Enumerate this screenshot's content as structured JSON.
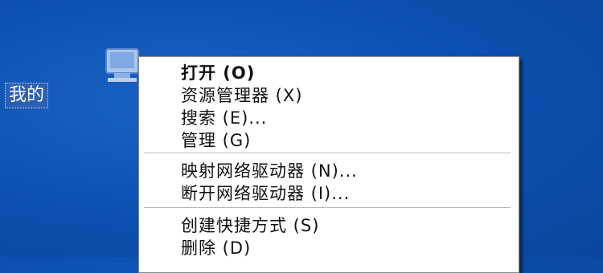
{
  "desktop": {
    "icon_label": "我的"
  },
  "menu": {
    "groups": [
      [
        {
          "label": "打开 (O)",
          "bold": true
        },
        {
          "label": "资源管理器 (X)"
        },
        {
          "label": "搜索 (E)..."
        },
        {
          "label": "管理 (G)"
        }
      ],
      [
        {
          "label": "映射网络驱动器 (N)..."
        },
        {
          "label": "断开网络驱动器 (I)..."
        }
      ],
      [
        {
          "label": "创建快捷方式 (S)"
        },
        {
          "label": "删除 (D)"
        }
      ]
    ]
  },
  "colors": {
    "desktop_bg": "#0c4fae",
    "label_highlight": "#2f5fb3",
    "menu_bg": "#ffffff"
  }
}
